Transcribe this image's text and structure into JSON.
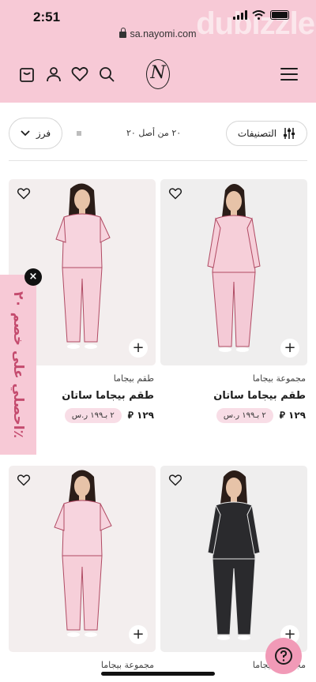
{
  "status": {
    "time": "2:51"
  },
  "browser": {
    "url": "sa.nayomi.com",
    "watermark": "dubizzle"
  },
  "header": {
    "logo_letter": "N",
    "icons": [
      "bag-icon",
      "user-icon",
      "heart-icon",
      "search-icon",
      "menu-icon"
    ]
  },
  "toolbar": {
    "sort_label": "فرز",
    "count_text": "٢٠ من أصل ٢٠",
    "filter_label": "التصنيفات"
  },
  "products": [
    {
      "category": "مجموعة بيجاما",
      "name": "طقم بيجاما ساتان",
      "price": "١٢٩",
      "promo": "٢ بـ١٩٩ ر.س",
      "style": "pink-long"
    },
    {
      "category": "طقم بيجاما",
      "name": "طقم بيجاما ساتان",
      "price": "١٢٩",
      "promo": "٢ بـ١٩٩ ر.س",
      "style": "pink-short"
    },
    {
      "category": "مجموعة بيجاما",
      "name": "",
      "price": "",
      "promo": "",
      "style": "black-long"
    },
    {
      "category": "مجموعة بيجاما",
      "name": "",
      "price": "",
      "promo": "",
      "style": "pink-short-sleeve"
    }
  ],
  "promo_tab": {
    "text": "احصلي على خصم ٢٠٪",
    "close": "×"
  },
  "help": {
    "icon": "question-icon"
  },
  "colors": {
    "brand_pink": "#f7c9d6",
    "promo_bg": "#f8dde6",
    "accent": "#c44b6e"
  }
}
